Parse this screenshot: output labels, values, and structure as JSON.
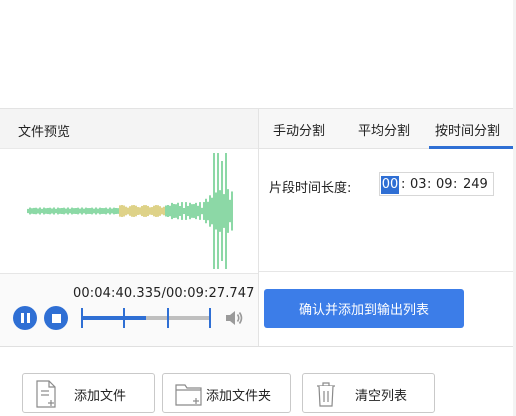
{
  "preview": {
    "title": "文件预览",
    "current_time": "00:04:40.335",
    "total_time": "00:09:27.747",
    "time_display": "00:04:40.335/00:09:27.747",
    "progress_fraction": 0.5
  },
  "split": {
    "tabs": [
      {
        "label": "手动分割",
        "active": false
      },
      {
        "label": "平均分割",
        "active": false
      },
      {
        "label": "按时间分割",
        "active": true
      }
    ],
    "segment_label": "片段时间长度:",
    "segment_time": {
      "hh": "00",
      "mm": "03",
      "ss": "09",
      "ms": "249"
    },
    "confirm_label": "确认并添加到输出列表"
  },
  "actions": {
    "add_file": "添加文件",
    "add_folder": "添加文件夹",
    "clear_list": "清空列表"
  },
  "colors": {
    "accent": "#2f6fd4",
    "button_blue": "#3c7de8",
    "wave_green": "#3fbf6a",
    "wave_yellow": "#c9b43a"
  }
}
